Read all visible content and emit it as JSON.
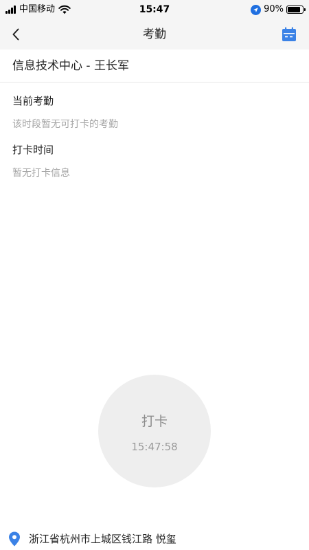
{
  "status_bar": {
    "carrier": "中国移动",
    "time": "15:47",
    "battery_percent": "90%",
    "battery_level": 0.9
  },
  "nav": {
    "title": "考勤",
    "back_icon": "chevron-left-icon",
    "calendar_icon": "calendar-icon"
  },
  "header": {
    "department_user": "信息技术中心 - 王长军"
  },
  "current_attendance": {
    "heading": "当前考勤",
    "message": "该时段暂无可打卡的考勤"
  },
  "punch_times": {
    "heading": "打卡时间",
    "message": "暂无打卡信息"
  },
  "punch_button": {
    "label": "打卡",
    "time": "15:47:58"
  },
  "location": {
    "address": "浙江省杭州市上城区钱江路 悦玺",
    "icon": "map-pin-icon"
  },
  "colors": {
    "accent": "#3b82e6",
    "muted_text": "#a6a6a6",
    "punch_bg": "#eeeeee",
    "topbar_bg": "#f5f5f5"
  }
}
